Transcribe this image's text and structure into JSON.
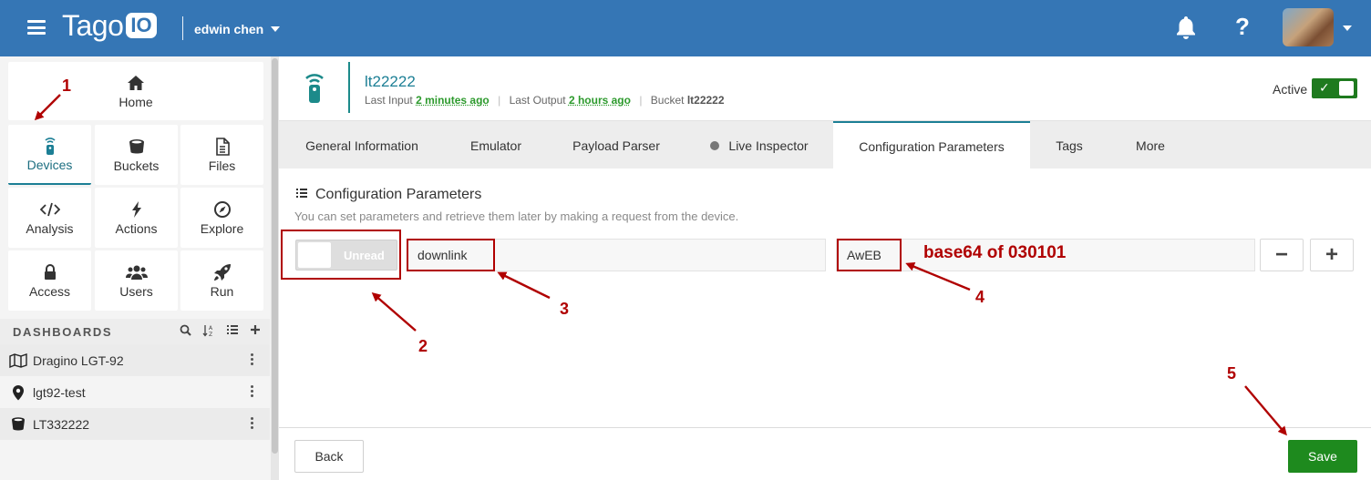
{
  "topbar": {
    "logo_text": "Tago",
    "logo_suffix": "IO",
    "account_name": "edwin chen",
    "icons": [
      "menu-icon",
      "bell-icon",
      "help-icon",
      "avatar"
    ]
  },
  "sidebar": {
    "tiles": [
      {
        "label": "Home",
        "icon": "home-icon"
      },
      {
        "label": "Devices",
        "icon": "device-icon",
        "active": true
      },
      {
        "label": "Buckets",
        "icon": "bucket-icon"
      },
      {
        "label": "Files",
        "icon": "file-icon"
      },
      {
        "label": "Analysis",
        "icon": "code-icon"
      },
      {
        "label": "Actions",
        "icon": "bolt-icon"
      },
      {
        "label": "Explore",
        "icon": "compass-icon"
      },
      {
        "label": "Access",
        "icon": "lock-icon"
      },
      {
        "label": "Users",
        "icon": "users-icon"
      },
      {
        "label": "Run",
        "icon": "rocket-icon"
      }
    ],
    "dashboards_title": "DASHBOARDS",
    "dashboard_tools": [
      "search-icon",
      "sort-az-icon",
      "list-icon",
      "plus-icon"
    ],
    "dashboards": [
      {
        "label": "Dragino LGT-92",
        "icon": "map-icon"
      },
      {
        "label": "lgt92-test",
        "icon": "map-pin-icon"
      },
      {
        "label": "LT332222",
        "icon": "bucket-icon"
      }
    ]
  },
  "device": {
    "name": "lt22222",
    "last_input_label": "Last Input",
    "last_input_value": "2 minutes ago",
    "last_output_label": "Last Output",
    "last_output_value": "2 hours ago",
    "bucket_label": "Bucket",
    "bucket_value": "lt22222",
    "active_label": "Active",
    "active_check": "✓"
  },
  "tabs": [
    {
      "label": "General Information"
    },
    {
      "label": "Emulator"
    },
    {
      "label": "Payload Parser"
    },
    {
      "label": "Live Inspector"
    },
    {
      "label": "Configuration Parameters",
      "active": true
    },
    {
      "label": "Tags"
    },
    {
      "label": "More"
    }
  ],
  "config": {
    "title": "Configuration Parameters",
    "description": "You can set parameters and retrieve them later by making a request from the device.",
    "param": {
      "status_label": "Unread",
      "key": "downlink",
      "value": "AwEB"
    },
    "remove_label": "−",
    "add_label": "+"
  },
  "footer": {
    "back_label": "Back",
    "save_label": "Save"
  },
  "annotations": {
    "numbers": [
      "1",
      "2",
      "3",
      "4",
      "5"
    ],
    "note": "base64 of 030101"
  },
  "colors": {
    "topbar": "#3576b5",
    "accent_teal": "#1c7f95",
    "save_green": "#1e8a1e",
    "annotation_red": "#b00000"
  }
}
